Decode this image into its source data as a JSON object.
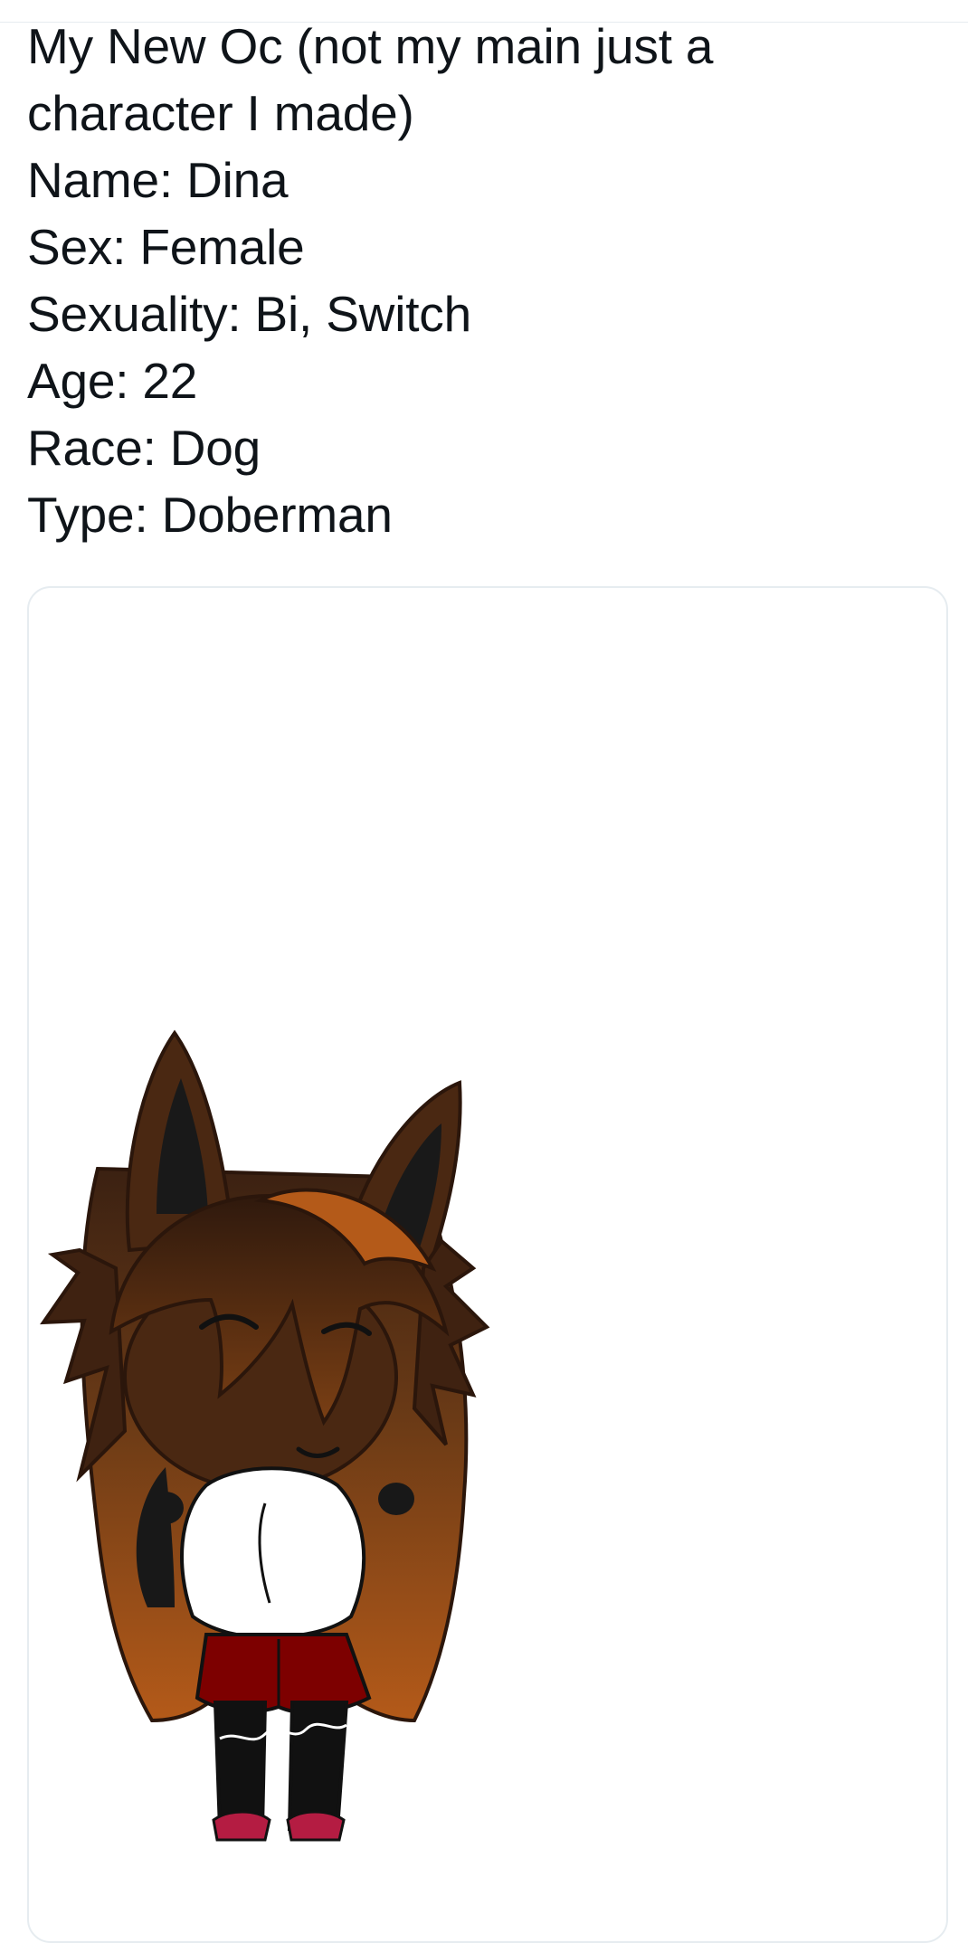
{
  "tweet": {
    "lines": [
      "My New Oc (not my main just a",
      "character I made)",
      "Name: Dina",
      "Sex: Female",
      "Sexuality: Bi, Switch",
      "Age: 22",
      "Race: Dog",
      "Type: Doberman"
    ]
  },
  "media": {
    "icon": "character-illustration",
    "colors": {
      "hair_dark": "#3b2112",
      "hair_mid": "#6a3a16",
      "hair_orange": "#b45a19",
      "ear_inner": "#191919",
      "shirt": "#ffffff",
      "shorts": "#7d0000",
      "legs": "#111111",
      "shoes": "#b41c42"
    }
  }
}
